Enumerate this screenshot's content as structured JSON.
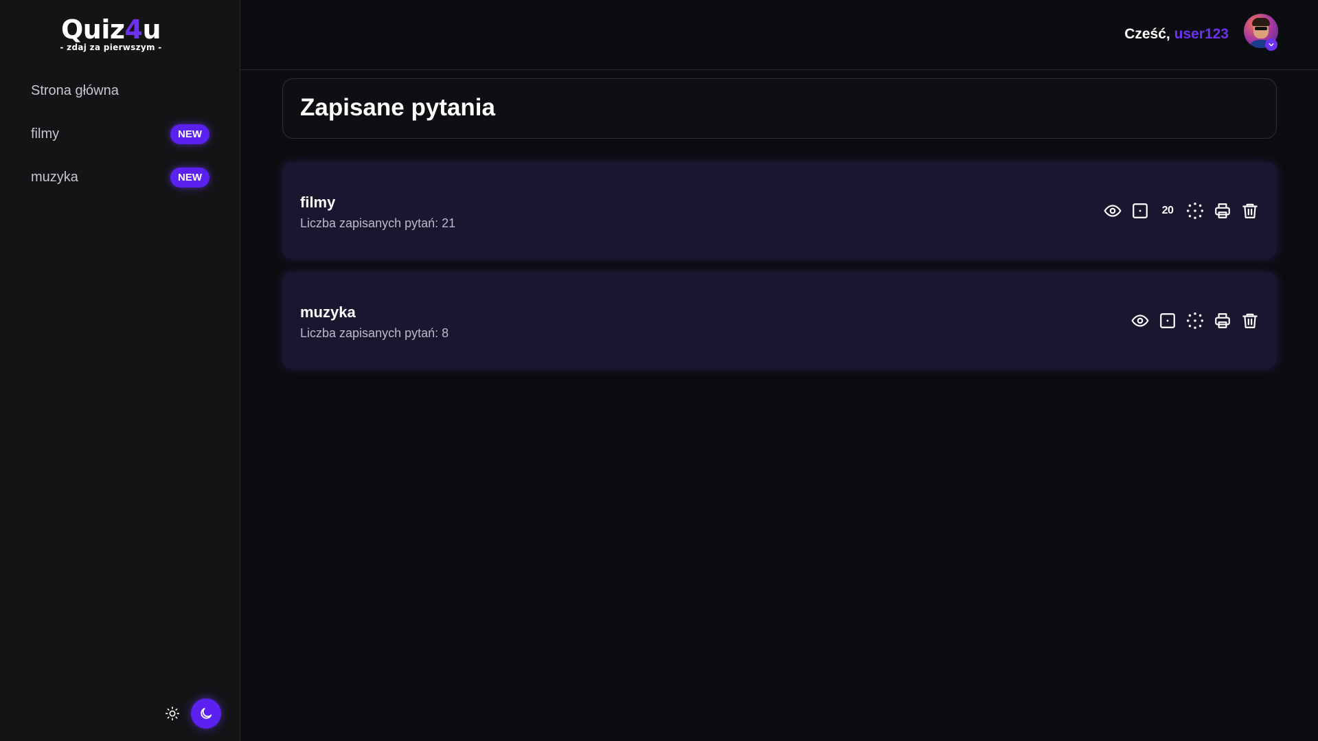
{
  "logo": {
    "title_main": "Quiz",
    "title_accent": "4",
    "title_end": "u",
    "subtitle": "- zdaj za pierwszym -"
  },
  "sidebar": {
    "items": [
      {
        "label": "Strona główna",
        "badge": ""
      },
      {
        "label": "filmy",
        "badge": "NEW"
      },
      {
        "label": "muzyka",
        "badge": "NEW"
      }
    ]
  },
  "header": {
    "greeting": "Cześć,",
    "username": "user123"
  },
  "main": {
    "title": "Zapisane pytania",
    "cards": [
      {
        "title": "filmy",
        "count": "Liczba zapisanych pytań: 21",
        "quick_label": "20"
      },
      {
        "title": "muzyka",
        "count": "Liczba zapisanych pytań: 8",
        "quick_label": ""
      }
    ]
  },
  "icons": {
    "sun": "sun-icon",
    "moon": "moon-icon",
    "eye": "eye-icon",
    "dice": "dice-icon",
    "shuffle": "scatter-dots-icon",
    "print": "printer-icon",
    "trash": "trash-icon",
    "chevron": "chevron-down-icon"
  },
  "colors": {
    "accent": "#5b21f0",
    "accent_text": "#6d32f0",
    "card_bg": "#1b1630",
    "bg": "#0c0d10",
    "sidebar_bg": "#141417"
  }
}
